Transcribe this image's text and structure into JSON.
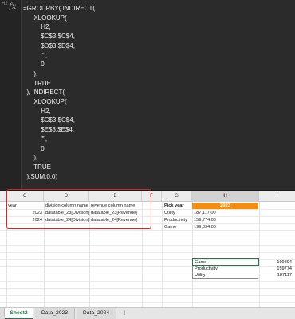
{
  "formula_bar": {
    "cell_ref": "H2",
    "fx_symbol": "fx",
    "formula_lines": [
      "=GROUPBY( INDIRECT(",
      "      XLOOKUP(",
      "          H2,",
      "          $C$3:$C$4,",
      "          $D$3:$D$4,",
      "          \"\",",
      "          0",
      "      ),",
      "      TRUE",
      "  ), INDIRECT(",
      "      XLOOKUP(",
      "          H2,",
      "          $C$3:$C$4,",
      "          $E$3:$E$4,",
      "          \"\",",
      "          0",
      "      ),",
      "      TRUE",
      "  ),SUM,0,0)"
    ]
  },
  "columns": [
    "C",
    "D",
    "E",
    "F",
    "G",
    "H",
    "I"
  ],
  "selected_column": "H",
  "lookup_table": {
    "headers": {
      "year": "year",
      "division": "division column name",
      "revenue": "revenue column name"
    },
    "rows": [
      {
        "year": "2023",
        "division": "datatable_23[Division]",
        "revenue": "datatable_23[Revenue]"
      },
      {
        "year": "2024",
        "division": "datatable_24[Division]",
        "revenue": "datatable_24[Revenue]"
      }
    ]
  },
  "pick": {
    "label": "Pick year",
    "value": "2023",
    "rows": [
      {
        "name": "Utility",
        "value": "187,117.00"
      },
      {
        "name": "Productivity",
        "value": "159,774.00"
      },
      {
        "name": "Game",
        "value": "199,894.00"
      }
    ]
  },
  "output": [
    {
      "name": "Game",
      "value": "199894"
    },
    {
      "name": "Productivity",
      "value": "159774"
    },
    {
      "name": "Utility",
      "value": "187117"
    }
  ],
  "sheets": {
    "tabs": [
      "Sheet2",
      "Data_2023",
      "Data_2024"
    ],
    "active": "Sheet2",
    "add_symbol": "+"
  },
  "colors": {
    "accent_green": "#1e7a47",
    "highlight_orange": "#f28e13",
    "callout_red": "#d5271d"
  }
}
